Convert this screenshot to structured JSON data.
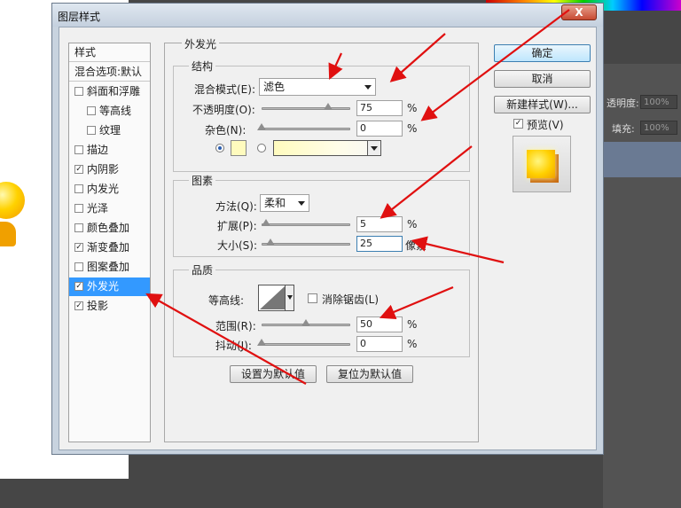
{
  "dialog": {
    "title": "图层样式",
    "close_label": "X"
  },
  "left_list": {
    "header": "样式",
    "blend_options": "混合选项:默认",
    "items": [
      {
        "label": "斜面和浮雕",
        "checked": false
      },
      {
        "label": "等高线",
        "checked": false
      },
      {
        "label": "纹理",
        "checked": false
      },
      {
        "label": "描边",
        "checked": false
      },
      {
        "label": "内阴影",
        "checked": true
      },
      {
        "label": "内发光",
        "checked": false
      },
      {
        "label": "光泽",
        "checked": false
      },
      {
        "label": "颜色叠加",
        "checked": false
      },
      {
        "label": "渐变叠加",
        "checked": true
      },
      {
        "label": "图案叠加",
        "checked": false
      },
      {
        "label": "外发光",
        "checked": true,
        "selected": true
      },
      {
        "label": "投影",
        "checked": true
      }
    ],
    "check_mark": "✓"
  },
  "outer_glow": {
    "title": "外发光",
    "structure": {
      "title": "结构",
      "blend_mode_label": "混合模式(E):",
      "blend_mode_value": "滤色",
      "opacity_label": "不透明度(O):",
      "opacity_value": "75",
      "opacity_fraction": 0.75,
      "noise_label": "杂色(N):",
      "noise_value": "0",
      "noise_fraction": 0,
      "percent": "%",
      "glow_color": "#fffbbe"
    },
    "elements": {
      "title": "图素",
      "method_label": "方法(Q):",
      "method_value": "柔和",
      "spread_label": "扩展(P):",
      "spread_value": "5",
      "spread_fraction": 0.05,
      "size_label": "大小(S):",
      "size_value": "25",
      "size_unit": "像素",
      "size_fraction": 0.1,
      "percent": "%"
    },
    "quality": {
      "title": "品质",
      "contour_label": "等高线:",
      "antialias_label": "消除锯齿(L)",
      "range_label": "范围(R):",
      "range_value": "50",
      "range_fraction": 0.5,
      "jitter_label": "抖动(J):",
      "jitter_value": "0",
      "jitter_fraction": 0,
      "percent": "%"
    },
    "set_default": "设置为默认值",
    "reset_default": "复位为默认值"
  },
  "buttons": {
    "ok": "确定",
    "cancel": "取消",
    "new_style": "新建样式(W)...",
    "preview": "预览(V)",
    "preview_checked": true
  },
  "background": {
    "opacity_label": "透明度:",
    "opacity_value": "100%",
    "fill_label": "填充:",
    "fill_value": "100%"
  },
  "colors": {
    "selection": "#3399ff",
    "arrow": "#e01010"
  }
}
